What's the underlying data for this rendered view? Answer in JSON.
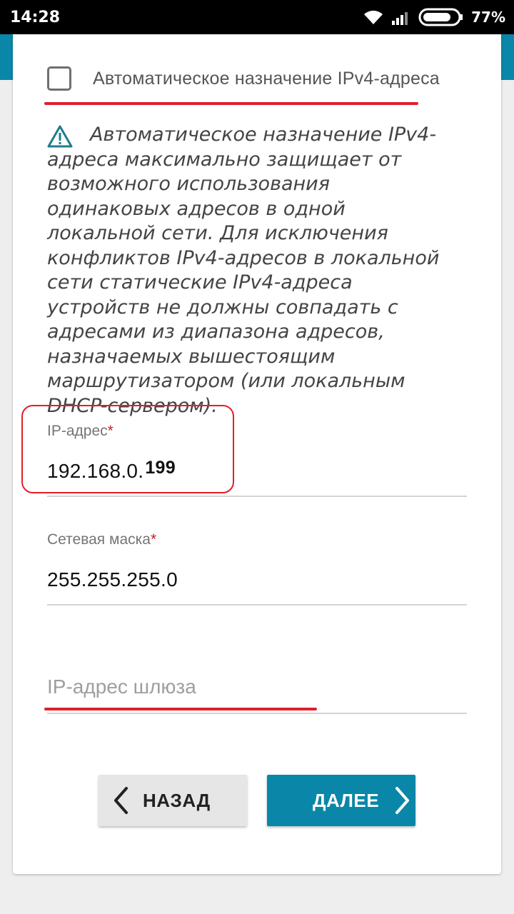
{
  "status_bar": {
    "time": "14:28",
    "battery_percent": "77%",
    "icons": [
      "wifi-icon",
      "signal-icon",
      "battery-icon"
    ]
  },
  "auto_ipv4": {
    "label": "Автоматическое назначение IPv4-адреса",
    "checked": false
  },
  "warning": {
    "icon": "warning-triangle-icon",
    "text": "Автоматическое назначение IPv4-адреса максимально защищает от возможного использования одинаковых адресов в одной локальной сети. Для исключения конфликтов IPv4-адресов в локальной сети статические IPv4-адреса устройств не должны совпадать с адресами из диапазона адресов, назначаемых вышестоящим маршрутизатором (или локальным DHCP-сервером)."
  },
  "fields": {
    "ip": {
      "label": "IP-адрес",
      "required_mark": "*",
      "value_prefix": "192.168.0.",
      "value_suffix": "199"
    },
    "mask": {
      "label": "Сетевая маска",
      "required_mark": "*",
      "value": "255.255.255.0"
    },
    "gateway": {
      "placeholder": "IP-адрес шлюза",
      "value": ""
    }
  },
  "buttons": {
    "back": "НАЗАД",
    "next": "ДАЛЕЕ"
  },
  "colors": {
    "accent": "#0a87a8",
    "annotation_red": "#e0202a",
    "required": "#c8201f"
  }
}
